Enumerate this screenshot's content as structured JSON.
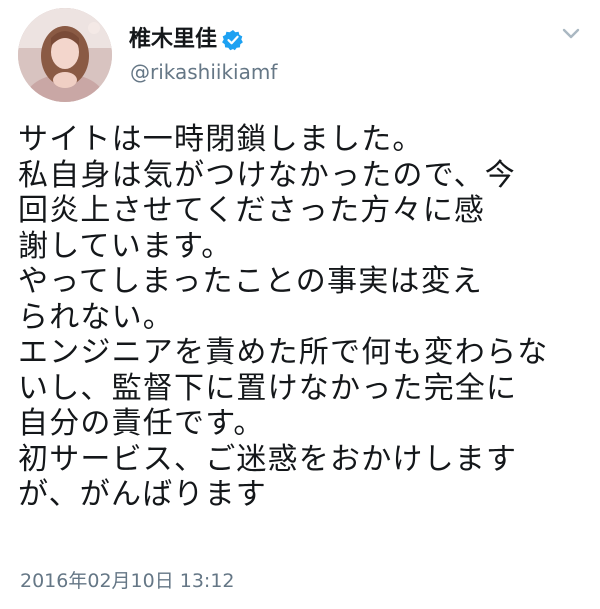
{
  "tweet": {
    "author": {
      "display_name": "椎木里佳",
      "handle": "@rikashiikiamf",
      "verified": true
    },
    "lines": [
      "サイトは一時閉鎖しました。",
      "私自身は気がつけなかったので、今",
      "回炎上させてくださった方々に感",
      "謝しています。",
      "やってしまったことの事実は変え",
      "られない。",
      "エンジニアを責めた所で何も変わらな",
      "いし、監督下に置けなかった完全に",
      "自分の責任です。",
      "初サービス、ご迷惑をおかけします",
      "が、がんばります"
    ],
    "timestamp": "2016年02月10日 13:12"
  },
  "icons": {
    "verified": "verified-badge-icon",
    "menu": "chevron-down-icon"
  },
  "colors": {
    "text": "#14171a",
    "secondary": "#657786",
    "verified_blue": "#1da1f2",
    "background": "#ffffff"
  }
}
